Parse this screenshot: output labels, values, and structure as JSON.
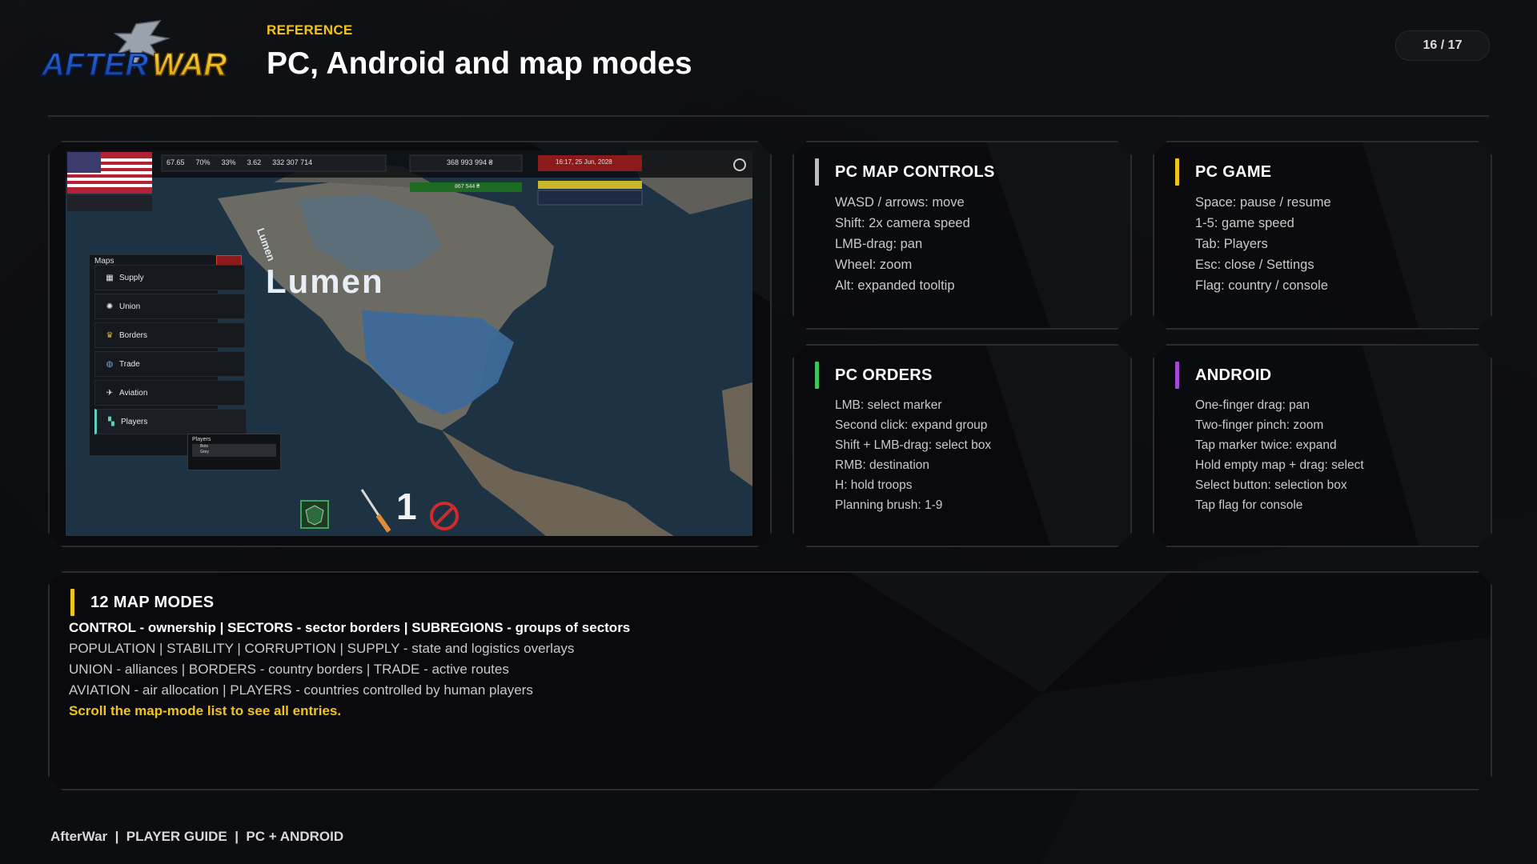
{
  "header": {
    "logo_text": "AFTERWAR",
    "kicker": "REFERENCE",
    "title": "PC, Android and map modes",
    "page_indicator": "16 / 17"
  },
  "screenshot": {
    "hud_stats": [
      "67.65",
      "70%",
      "33%",
      "3.62",
      "332 307 714"
    ],
    "treasury": "368 993 994 ₴",
    "treasury_delta": "867 544 ₴",
    "date": "16:17, 25 Jun, 2028",
    "map_label_large": "Lumen",
    "map_label_small": "Lumen",
    "maps_menu": {
      "header": "Maps",
      "items": [
        "Supply",
        "Union",
        "Borders",
        "Trade",
        "Aviation",
        "Players"
      ]
    },
    "players_popup": {
      "title": "Players",
      "rows": [
        "Bots",
        "Grey"
      ]
    },
    "brush_number": "1"
  },
  "cards": {
    "pc_map_controls": {
      "title": "PC MAP CONTROLS",
      "accent": "#bdbdbd",
      "lines": [
        "WASD / arrows: move",
        "Shift: 2x camera speed",
        "LMB-drag: pan",
        "Wheel: zoom",
        "Alt: expanded tooltip"
      ]
    },
    "pc_game": {
      "title": "PC GAME",
      "accent": "#f0c419",
      "lines": [
        "Space: pause / resume",
        "1-5: game speed",
        "Tab: Players",
        "Esc: close / Settings",
        "Flag: country / console"
      ]
    },
    "pc_orders": {
      "title": "PC ORDERS",
      "accent": "#3fc35a",
      "lines": [
        "LMB: select marker",
        "Second click: expand group",
        "Shift + LMB-drag: select box",
        "RMB: destination",
        "H: hold troops",
        "Planning brush: 1-9"
      ]
    },
    "android": {
      "title": "ANDROID",
      "accent": "#a64ad6",
      "lines": [
        "One-finger drag: pan",
        "Two-finger pinch: zoom",
        "Tap marker twice: expand",
        "Hold empty map + drag: select",
        "Select button: selection box",
        "Tap flag for console"
      ]
    }
  },
  "map_modes": {
    "title": "12 MAP MODES",
    "accent": "#f0c419",
    "line1": "CONTROL - ownership | SECTORS - sector borders | SUBREGIONS - groups of sectors",
    "line2": "POPULATION | STABILITY | CORRUPTION | SUPPLY - state and logistics overlays",
    "line3": "UNION - alliances | BORDERS - country borders | TRADE - active routes",
    "line4": "AVIATION - air allocation | PLAYERS - countries controlled by human players",
    "note": "Scroll the map-mode list to see all entries."
  },
  "footer": {
    "text": "AfterWar  |  PLAYER GUIDE  |  PC + ANDROID"
  }
}
